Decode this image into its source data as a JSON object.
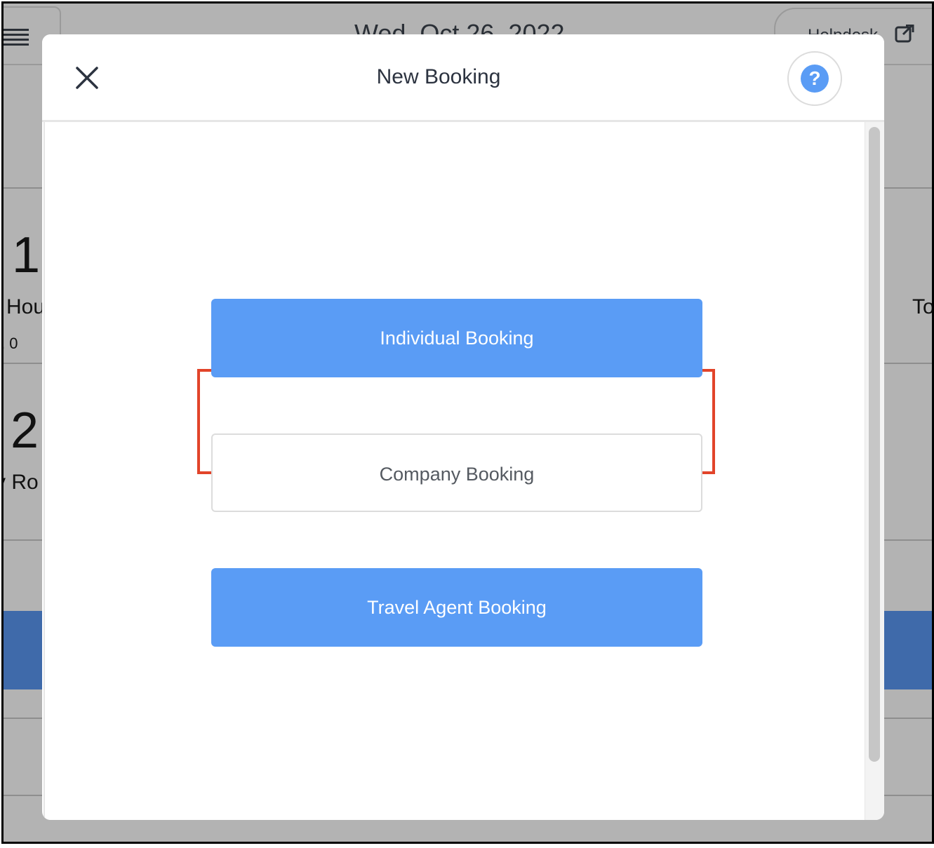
{
  "background": {
    "date": "Wed, Oct 26, 2022",
    "helpdesk_label": "Helpdesk",
    "stat1_value": "1",
    "stat1_label": "Hou",
    "stat1_sub": ", 0",
    "stat2_value": "2",
    "stat2_label": "y Ro",
    "right_label": "To"
  },
  "modal": {
    "title": "New Booking",
    "close_icon": "close-icon",
    "help_icon": "question-icon",
    "help_glyph": "?",
    "buttons": {
      "individual": "Individual Booking",
      "company": "Company Booking",
      "travel_agent": "Travel Agent Booking"
    }
  },
  "colors": {
    "primary": "#5a9cf5",
    "highlight": "#e2442a",
    "overlay": "#b3b3b3",
    "band": "#3f6aaa"
  }
}
